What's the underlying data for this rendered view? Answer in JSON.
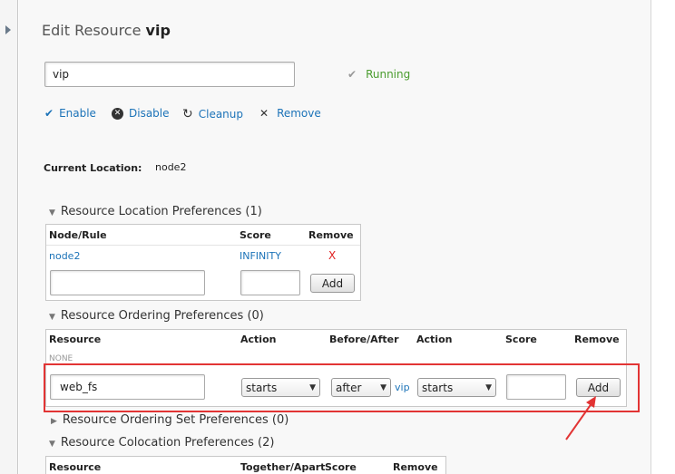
{
  "page": {
    "title_prefix": "Edit Resource",
    "title_name": "vip",
    "name_value": "vip",
    "status_text": "Running",
    "actions": {
      "enable": "Enable",
      "disable": "Disable",
      "cleanup": "Cleanup",
      "remove": "Remove"
    },
    "current_location_label": "Current Location:",
    "current_location_value": "node2"
  },
  "location_prefs": {
    "heading": "Resource Location Preferences (1)",
    "columns": [
      "Node/Rule",
      "Score",
      "Remove"
    ],
    "rows": [
      {
        "node": "node2",
        "score": "INFINITY",
        "remove": "X"
      }
    ],
    "add_button": "Add"
  },
  "ordering_prefs": {
    "heading": "Resource Ordering Preferences (0)",
    "columns": [
      "Resource",
      "Action",
      "Before/After",
      "Action",
      "Score",
      "Remove"
    ],
    "empty_text": "NONE",
    "form": {
      "resource_value": "web_fs",
      "action1": "starts",
      "before_after": "after",
      "target": "vip",
      "action2": "starts",
      "score": "",
      "add_button": "Add"
    }
  },
  "ordering_set_prefs": {
    "heading": "Resource Ordering Set Preferences (0)"
  },
  "colocation_prefs": {
    "heading": "Resource Colocation Preferences (2)",
    "columns": [
      "Resource",
      "Together/Apart",
      "Score",
      "Remove"
    ]
  },
  "colors": {
    "link": "#1c73b8",
    "running": "#4a9c2e",
    "highlight": "#e23434",
    "remove_x": "#e02020"
  }
}
